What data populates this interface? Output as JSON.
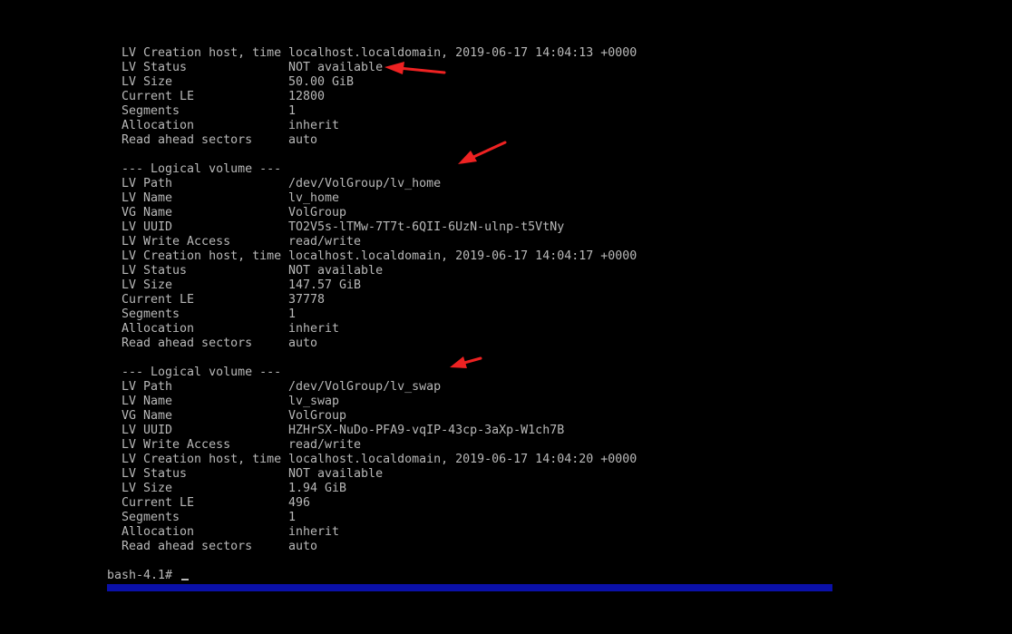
{
  "colors": {
    "background": "#000000",
    "text": "#b8b8b8",
    "status_bar": "#0a10a8",
    "annotation_arrow": "#ee2222"
  },
  "top_block": [
    {
      "key": "LV Creation host, time",
      "value": "localhost.localdomain, 2019-06-17 14:04:13 +0000"
    },
    {
      "key": "LV Status",
      "value": "NOT available"
    },
    {
      "key": "LV Size",
      "value": "50.00 GiB"
    },
    {
      "key": "Current LE",
      "value": "12800"
    },
    {
      "key": "Segments",
      "value": "1"
    },
    {
      "key": "Allocation",
      "value": "inherit"
    },
    {
      "key": "Read ahead sectors",
      "value": "auto"
    }
  ],
  "volumes": [
    {
      "header": "--- Logical volume ---",
      "fields": [
        {
          "key": "LV Path",
          "value": "/dev/VolGroup/lv_home"
        },
        {
          "key": "LV Name",
          "value": "lv_home"
        },
        {
          "key": "VG Name",
          "value": "VolGroup"
        },
        {
          "key": "LV UUID",
          "value": "TO2V5s-lTMw-7T7t-6QII-6UzN-ulnp-t5VtNy"
        },
        {
          "key": "LV Write Access",
          "value": "read/write"
        },
        {
          "key": "LV Creation host, time",
          "value": "localhost.localdomain, 2019-06-17 14:04:17 +0000"
        },
        {
          "key": "LV Status",
          "value": "NOT available"
        },
        {
          "key": "LV Size",
          "value": "147.57 GiB"
        },
        {
          "key": "Current LE",
          "value": "37778"
        },
        {
          "key": "Segments",
          "value": "1"
        },
        {
          "key": "Allocation",
          "value": "inherit"
        },
        {
          "key": "Read ahead sectors",
          "value": "auto"
        }
      ]
    },
    {
      "header": "--- Logical volume ---",
      "fields": [
        {
          "key": "LV Path",
          "value": "/dev/VolGroup/lv_swap"
        },
        {
          "key": "LV Name",
          "value": "lv_swap"
        },
        {
          "key": "VG Name",
          "value": "VolGroup"
        },
        {
          "key": "LV UUID",
          "value": "HZHrSX-NuDo-PFA9-vqIP-43cp-3aXp-W1ch7B"
        },
        {
          "key": "LV Write Access",
          "value": "read/write"
        },
        {
          "key": "LV Creation host, time",
          "value": "localhost.localdomain, 2019-06-17 14:04:20 +0000"
        },
        {
          "key": "LV Status",
          "value": "NOT available"
        },
        {
          "key": "LV Size",
          "value": "1.94 GiB"
        },
        {
          "key": "Current LE",
          "value": "496"
        },
        {
          "key": "Segments",
          "value": "1"
        },
        {
          "key": "Allocation",
          "value": "inherit"
        },
        {
          "key": "Read ahead sectors",
          "value": "auto"
        }
      ]
    }
  ],
  "prompt": {
    "text": "bash-4.1# "
  },
  "annotations": [
    {
      "name": "red-arrow-icon"
    },
    {
      "name": "red-arrow-icon"
    },
    {
      "name": "red-arrow-icon"
    }
  ]
}
